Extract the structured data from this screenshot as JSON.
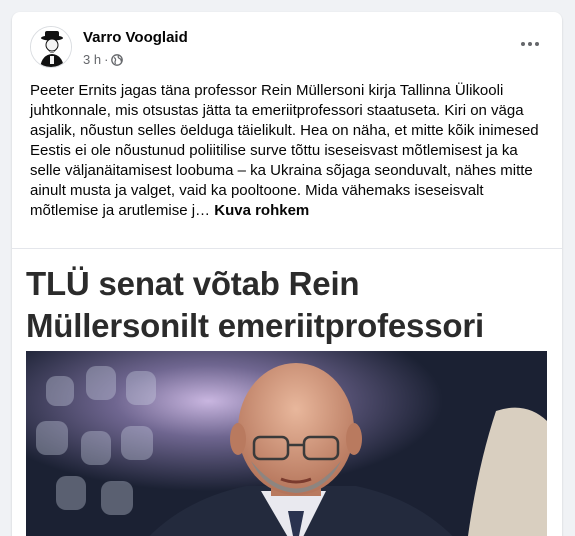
{
  "post": {
    "author": "Varro Vooglaid",
    "time": "3 h",
    "separator": "·",
    "privacy_icon": "globe-icon",
    "menu_icon": "more-horizontal-icon",
    "body": "Peeter Ernits jagas täna professor Rein Müllersoni kirja Tallinna Ülikooli juhtkonnale, mis otsustas jätta ta emeriitprofessori staatuseta. Kiri on väga asjalik, nõustun selles öelduga täielikult. Hea on näha, et mitte kõik inimesed Eestis ei ole nõustunud poliitilise surve tõttu iseseisvast mõtlemisest ja ka selle väljanäitamisest loobuma – ka Ukraina sõjaga seonduvalt, nähes mitte ainult musta ja valget, vaid ka pooltoone. Mida vähemaks iseseisvalt mõtlemise ja arutlemise j…",
    "see_more": "Kuva rohkem"
  },
  "link": {
    "headline": "TLÜ senat võtab Rein Müllersonilt emeriitprofessori staatuse ära",
    "image": "portrait-photo"
  },
  "colors": {
    "background": "#f0f2f5",
    "card": "#ffffff",
    "text": "#050505",
    "secondary": "#65676b",
    "headline": "#2b2b2b"
  }
}
